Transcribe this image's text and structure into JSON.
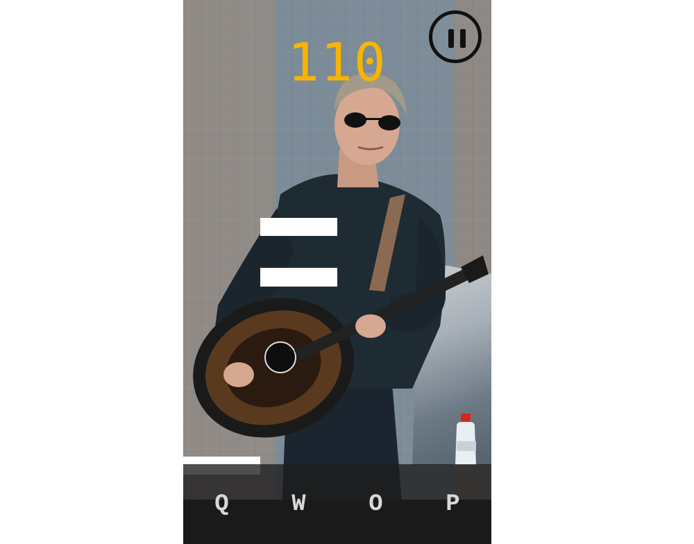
{
  "game": {
    "score": "110",
    "pause_icon": "pause-icon",
    "keys": [
      "Q",
      "W",
      "O",
      "P"
    ],
    "colors": {
      "score": "#f7b500",
      "tile": "#ffffff",
      "keybar": "#1c1c1c",
      "pause_ring": "#111111"
    },
    "tiles_visible": 3
  }
}
